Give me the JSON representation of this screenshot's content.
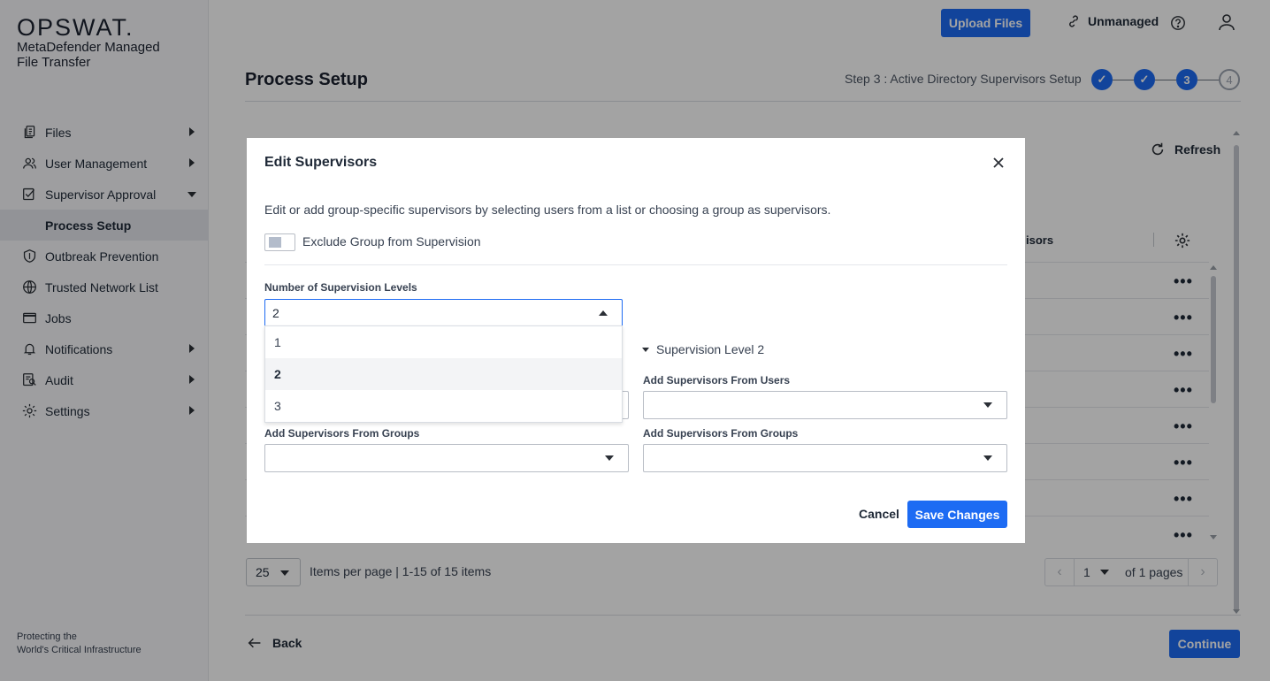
{
  "brand": {
    "logo": "OPSWAT.",
    "product": "MetaDefender Managed File Transfer",
    "tagline_line1": "Protecting the",
    "tagline_line2": "World's Critical Infrastructure"
  },
  "sidebar": {
    "items": [
      {
        "label": "Files",
        "icon": "file-copy-icon",
        "expandable": true
      },
      {
        "label": "User Management",
        "icon": "users-icon",
        "expandable": true
      },
      {
        "label": "Supervisor Approval",
        "icon": "checkbox-edit-icon",
        "expanded": true
      },
      {
        "label": "Process Setup",
        "sub": true,
        "active": true
      },
      {
        "label": "Outbreak Prevention",
        "icon": "shield-icon"
      },
      {
        "label": "Trusted Network List",
        "icon": "globe-icon"
      },
      {
        "label": "Jobs",
        "icon": "window-icon"
      },
      {
        "label": "Notifications",
        "icon": "bell-icon",
        "expandable": true
      },
      {
        "label": "Audit",
        "icon": "audit-icon",
        "expandable": true
      },
      {
        "label": "Settings",
        "icon": "gear-icon",
        "expandable": true
      }
    ]
  },
  "topbar": {
    "upload_label": "Upload Files",
    "unmanaged_label": "Unmanaged"
  },
  "page": {
    "title": "Process Setup",
    "step_label": "Step 3 : Active Directory Supervisors Setup",
    "steps": [
      "✓",
      "✓",
      "3",
      "4"
    ],
    "refresh_label": "Refresh",
    "column_header": "isors",
    "row_count": 8
  },
  "pager": {
    "page_size": "25",
    "items_text": "Items per page  |  1-15 of 15 items",
    "page": "1",
    "of_pages": "of 1 pages"
  },
  "footer": {
    "back_label": "Back",
    "continue_label": "Continue"
  },
  "modal": {
    "title": "Edit Supervisors",
    "description": "Edit or add group-specific supervisors by selecting users from a list or choosing a group as supervisors.",
    "exclude_label": "Exclude Group from Supervision",
    "levels_label": "Number of Supervision Levels",
    "levels_value": "2",
    "options": [
      "1",
      "2",
      "3"
    ],
    "selected_option": "2",
    "level2_title": "Supervision Level 2",
    "users_label": "Add Supervisors From Users",
    "groups_label": "Add Supervisors From Groups",
    "cancel_label": "Cancel",
    "save_label": "Save Changes"
  },
  "colors": {
    "primary": "#1d6bf3",
    "sidebar_bg": "#f7f8fa",
    "active_item_bg": "#e4e7ec",
    "overlay": "rgba(0,0,0,0.36)"
  }
}
